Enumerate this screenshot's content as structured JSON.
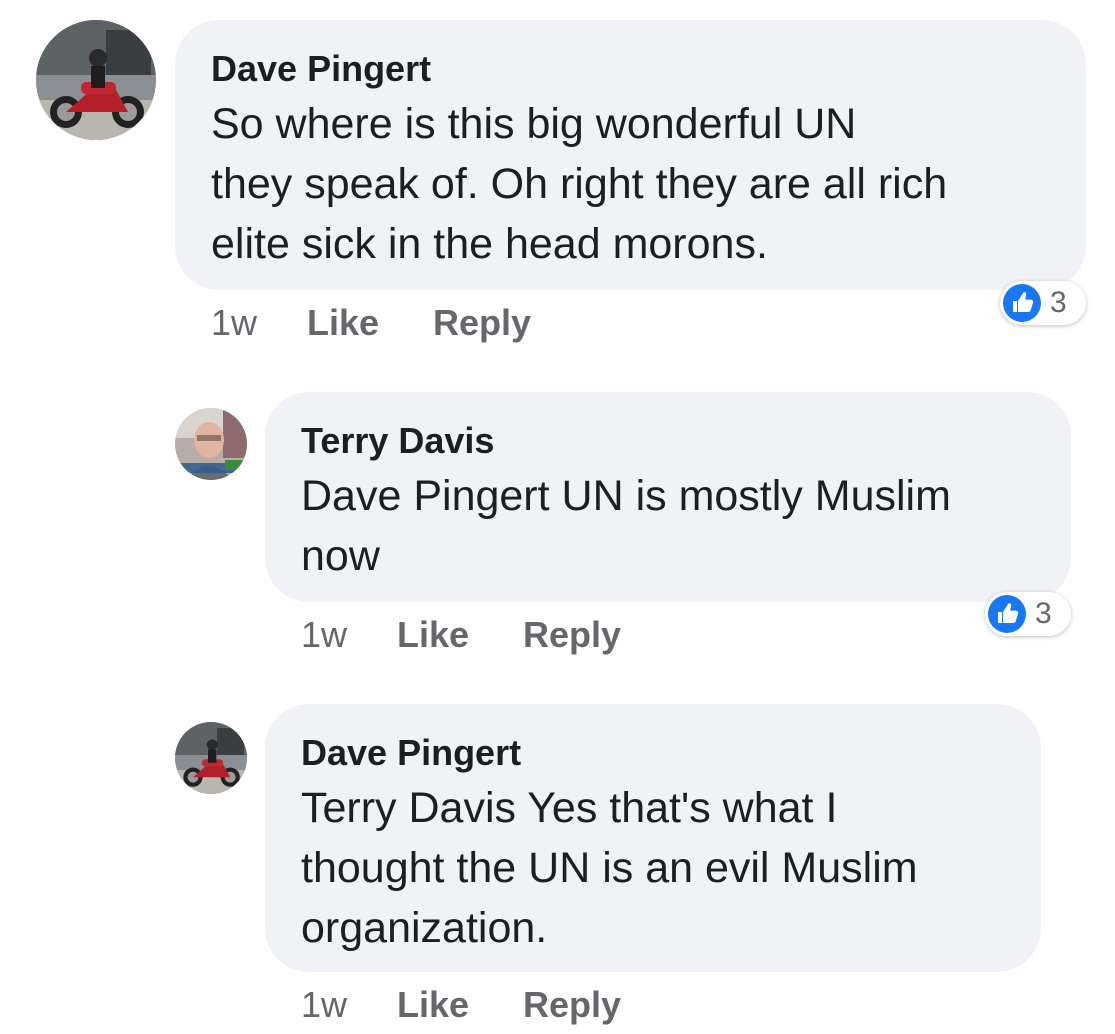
{
  "comments": [
    {
      "author": "Dave Pingert",
      "text": "So where is this big wonderful UN they speak of. Oh right they are all rich elite sick in the head morons.",
      "lines": [
        "So where is this big wonderful UN",
        "they speak of. Oh right they are all rich",
        "elite sick in the head morons."
      ],
      "time": "1w",
      "like_label": "Like",
      "reply_label": "Reply",
      "reaction_count": "3",
      "avatar_icon": "motorcycle-avatar-icon"
    },
    {
      "author": "Terry Davis",
      "text": "Dave Pingert UN is mostly Muslim now",
      "lines": [
        "Dave Pingert UN is mostly Muslim",
        "now"
      ],
      "time": "1w",
      "like_label": "Like",
      "reply_label": "Reply",
      "reaction_count": "3",
      "avatar_icon": "person-avatar-icon"
    },
    {
      "author": "Dave Pingert",
      "text": "Terry Davis Yes that's what I thought the UN is an evil Muslim organization.",
      "lines": [
        "Terry Davis Yes that's what I",
        "thought the UN is an evil Muslim",
        "organization."
      ],
      "time": "1w",
      "like_label": "Like",
      "reply_label": "Reply",
      "avatar_icon": "motorcycle-avatar-icon"
    }
  ],
  "colors": {
    "bubble": "#f0f2f5",
    "secondary_text": "#65676b",
    "like_blue": "#1877f2"
  }
}
